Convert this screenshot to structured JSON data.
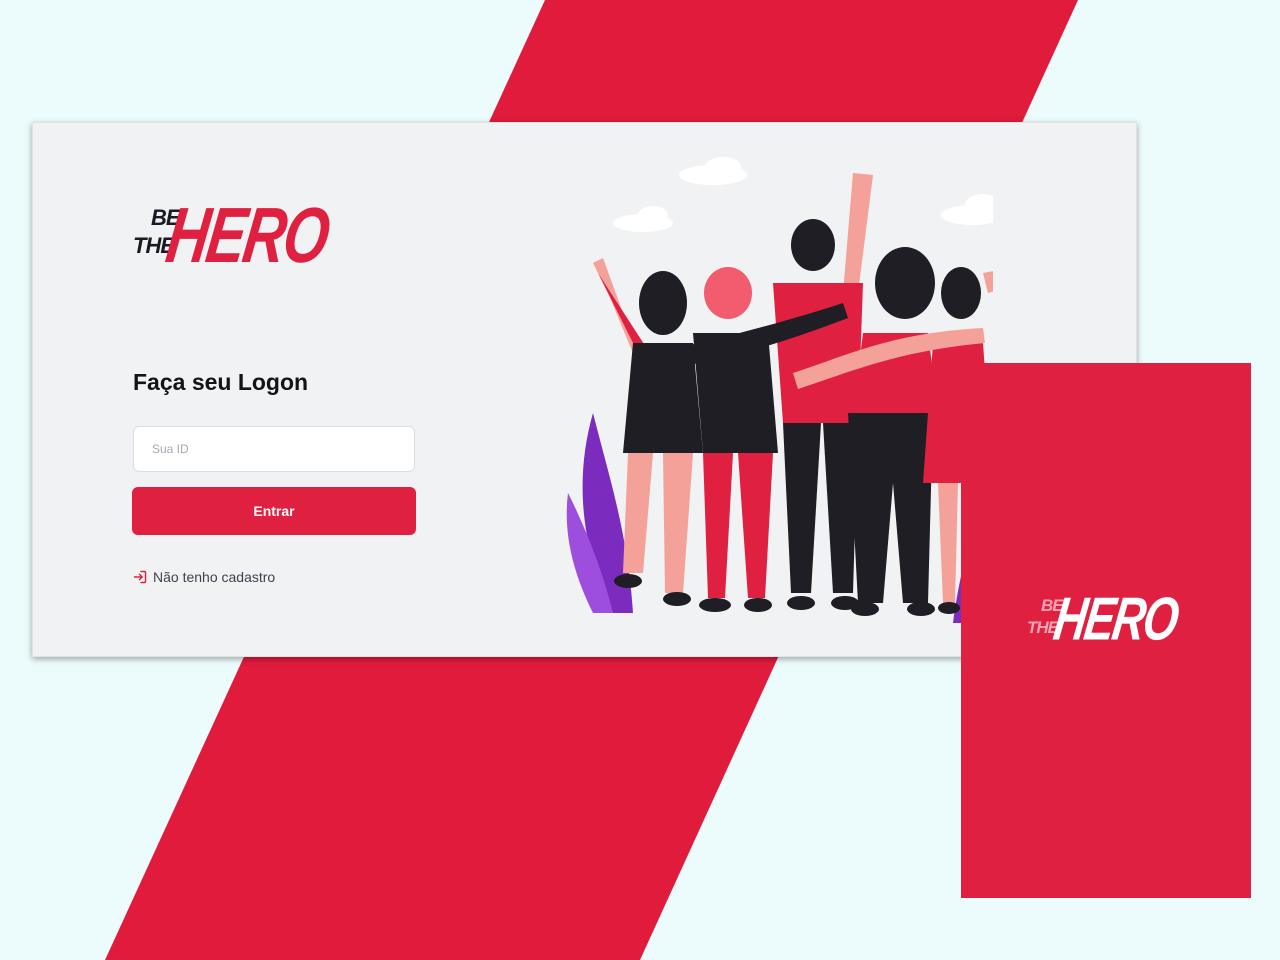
{
  "brand": {
    "logo_be": "BE",
    "logo_the": "THE",
    "logo_hero": "HERO"
  },
  "login": {
    "title": "Faça seu Logon",
    "id_placeholder": "Sua ID",
    "submit_label": "Entrar",
    "register_link_label": "Não tenho cadastro"
  },
  "icons": {
    "register": "log-in-icon",
    "illustration": "group-of-friends-illustration"
  },
  "colors": {
    "brand_red": "#e02041",
    "background": "#ecfbfb",
    "card": "#f0f2f3",
    "text_dark": "#13131a",
    "text_muted": "#41414d"
  }
}
